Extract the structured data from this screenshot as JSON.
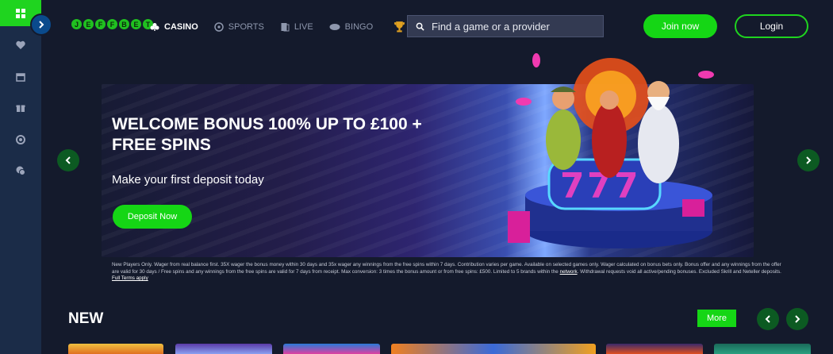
{
  "rail": {
    "icons": [
      "grid-icon",
      "heart-icon",
      "calendar-icon",
      "gift-icon",
      "support-icon",
      "chat-icon"
    ]
  },
  "brand": {
    "logo_letters": [
      "J",
      "E",
      "F",
      "F",
      "B",
      "E",
      "T"
    ],
    "green": "#15d615",
    "dark_bg": "#141a2c",
    "rail_bg": "#1b2c48"
  },
  "nav": {
    "items": [
      {
        "label": "CASINO",
        "icon": "clubs-icon",
        "active": true
      },
      {
        "label": "SPORTS",
        "icon": "ball-icon",
        "active": false
      },
      {
        "label": "LIVE",
        "icon": "live-cards-icon",
        "active": false
      },
      {
        "label": "BINGO",
        "icon": "bingo-icon",
        "active": false
      }
    ],
    "trophy_icon": "trophy-icon"
  },
  "search": {
    "placeholder": "Find a game or a provider"
  },
  "header": {
    "join_label": "Join now",
    "login_label": "Login"
  },
  "banner": {
    "headline": "WELCOME BONUS 100% UP TO £100 + FREE SPINS",
    "subline": "Make your first deposit today",
    "cta_label": "Deposit Now"
  },
  "terms": {
    "text": "New Players Only. Wager from real balance first. 35X wager the bonus money within 30 days and 35x wager any winnings from the free spins within 7 days. Contribution varies per game. Available on selected games only. Wager calculated on bonus bets only. Bonus offer and any winnings from the offer are valid for 30 days / Free spins and any winnings from the free spins are valid for 7 days from receipt. Max conversion: 3 times the bonus amount or from free spins: £500. Limited to 5 brands within the ",
    "network_link": "network",
    "text2": ". Withdrawal requests void all active/pending bonuses. Excluded Skrill and Neteller deposits. ",
    "full_terms_link": "Full Terms apply"
  },
  "section": {
    "title": "NEW",
    "more_label": "More"
  }
}
